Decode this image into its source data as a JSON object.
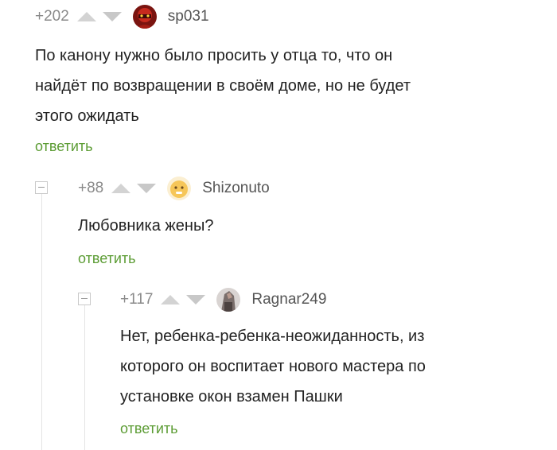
{
  "comments": [
    {
      "rating": "+202",
      "username": "sp031",
      "avatar": "red-helmet-avatar",
      "lines": [
        "По канону нужно было просить у отца то, что он",
        "найдёт по возвращении в своём доме, но не будет",
        "этого ожидать"
      ],
      "reply_label": "ответить"
    },
    {
      "rating": "+88",
      "username": "Shizonuto",
      "avatar": "yellow-face-avatar",
      "lines": [
        "Любовника жены?"
      ],
      "reply_label": "ответить"
    },
    {
      "rating": "+117",
      "username": "Ragnar249",
      "avatar": "grey-photo-avatar",
      "lines": [
        "Нет, ребенка-ребенка-неожиданность, из",
        "которого он воспитает нового мастера по",
        "установке окон взамен Пашки"
      ],
      "reply_label": "ответить"
    }
  ],
  "colors": {
    "reply": "#5c9c34",
    "rating": "#8a8a8a",
    "username": "#555555",
    "text": "#222222"
  }
}
